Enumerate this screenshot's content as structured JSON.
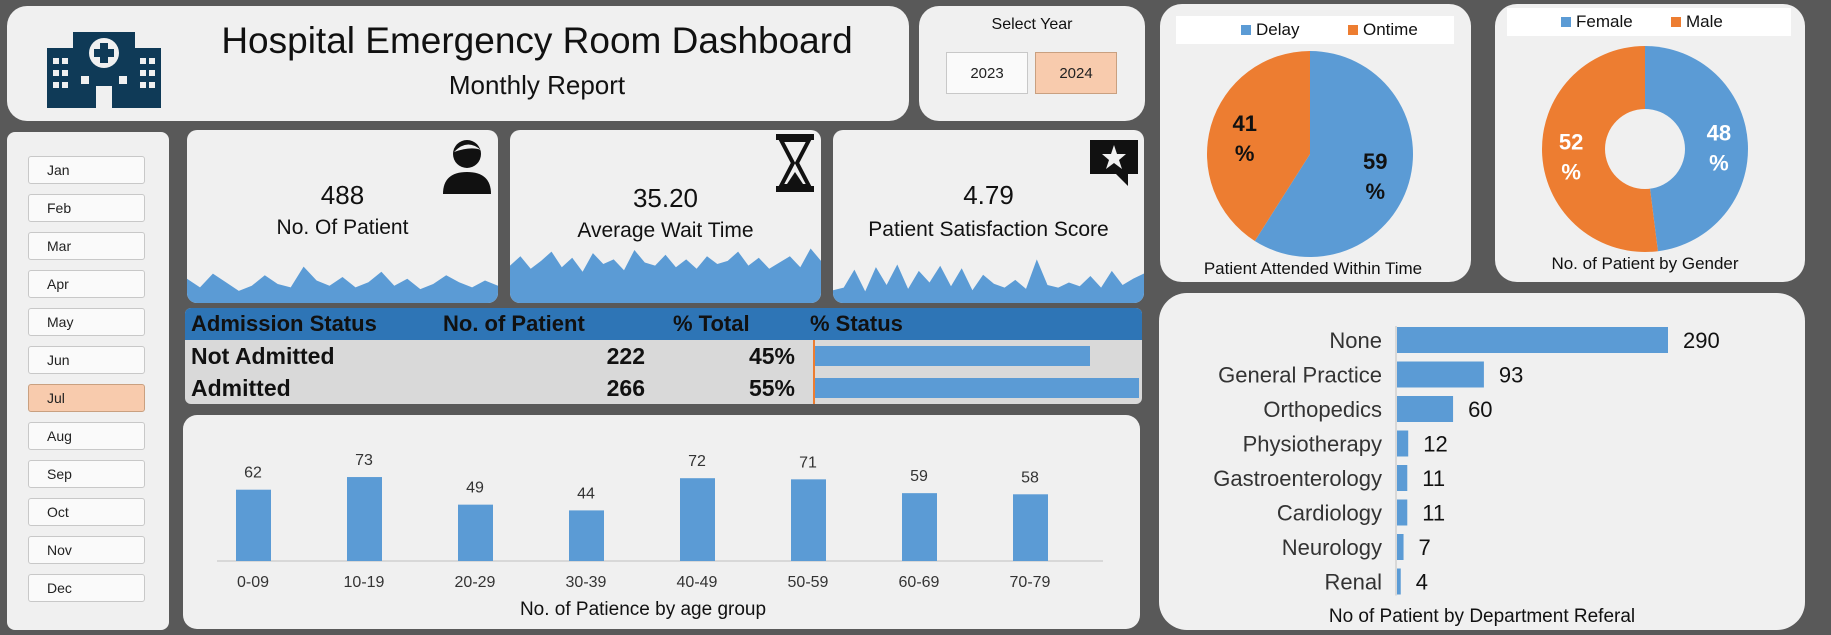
{
  "header": {
    "title": "Hospital Emergency Room Dashboard",
    "subtitle": "Monthly Report"
  },
  "year_selector": {
    "label": "Select Year",
    "years": [
      "2023",
      "2024"
    ],
    "selected": "2024"
  },
  "months": {
    "items": [
      "Jan",
      "Feb",
      "Mar",
      "Apr",
      "May",
      "Jun",
      "Jul",
      "Aug",
      "Sep",
      "Oct",
      "Nov",
      "Dec"
    ],
    "selected": "Jul"
  },
  "kpis": {
    "patients": {
      "value": "488",
      "label": "No. Of Patient"
    },
    "wait_time": {
      "value": "35.20",
      "label": "Average Wait Time"
    },
    "satisfaction": {
      "value": "4.79",
      "label": "Patient Satisfaction Score"
    }
  },
  "admission": {
    "headers": [
      "Admission Status",
      "No. of Patient",
      "% Total",
      "% Status"
    ],
    "rows": [
      {
        "status": "Not Admitted",
        "patients": "222",
        "pct": "45%",
        "fraction": 0.45
      },
      {
        "status": "Admitted",
        "patients": "266",
        "pct": "55%",
        "fraction": 0.55
      }
    ]
  },
  "colors": {
    "blue": "#5b9bd5",
    "orange": "#ed7d31",
    "highlight": "#f8cbad",
    "navy": "#0f3a57",
    "header_blue": "#2e75b6"
  },
  "chart_data": [
    {
      "type": "bar",
      "title": "No. of Patience by age group",
      "categories": [
        "0-09",
        "10-19",
        "20-29",
        "30-39",
        "40-49",
        "50-59",
        "60-69",
        "70-79"
      ],
      "values": [
        62,
        73,
        49,
        44,
        72,
        71,
        59,
        58
      ],
      "ylim": [
        0,
        80
      ]
    },
    {
      "type": "pie",
      "title": "Patient Attended Within Time",
      "legend": "top",
      "slices": [
        {
          "name": "Delay",
          "value": 59,
          "label": "59 %"
        },
        {
          "name": "Ontime",
          "value": 41,
          "label": "41 %"
        }
      ]
    },
    {
      "type": "pie",
      "title": "No. of Patient by Gender",
      "legend": "top",
      "donut": true,
      "slices": [
        {
          "name": "Female",
          "value": 48,
          "label": "48 %"
        },
        {
          "name": "Male",
          "value": 52,
          "label": "52 %"
        }
      ]
    },
    {
      "type": "bar",
      "orientation": "horizontal",
      "title": "No of Patient by Department Referal",
      "categories": [
        "None",
        "General Practice",
        "Orthopedics",
        "Physiotherapy",
        "Gastroenterology",
        "Cardiology",
        "Neurology",
        "Renal"
      ],
      "values": [
        290,
        93,
        60,
        12,
        11,
        11,
        7,
        4
      ],
      "xlim": [
        0,
        290
      ]
    },
    {
      "type": "area",
      "series": [
        {
          "name": "patients_trend",
          "values": [
            14,
            9,
            17,
            12,
            7,
            10,
            16,
            11,
            9,
            21,
            13,
            10,
            15,
            9,
            12,
            18,
            10,
            14,
            8,
            11,
            16,
            12,
            9,
            13,
            10
          ]
        },
        {
          "name": "wait_trend",
          "values": [
            24,
            30,
            22,
            27,
            33,
            23,
            29,
            20,
            32,
            25,
            28,
            21,
            34,
            26,
            24,
            31,
            23,
            28,
            22,
            30,
            25,
            27,
            33,
            24,
            29,
            22,
            26,
            30,
            23,
            35,
            27
          ]
        },
        {
          "name": "satisfaction_trend",
          "values": [
            10,
            12,
            26,
            9,
            28,
            14,
            30,
            11,
            25,
            16,
            29,
            13,
            27,
            10,
            22,
            15,
            12,
            18,
            11,
            34,
            14,
            12,
            16,
            13,
            21,
            12,
            25,
            14,
            19,
            23
          ]
        }
      ]
    }
  ]
}
